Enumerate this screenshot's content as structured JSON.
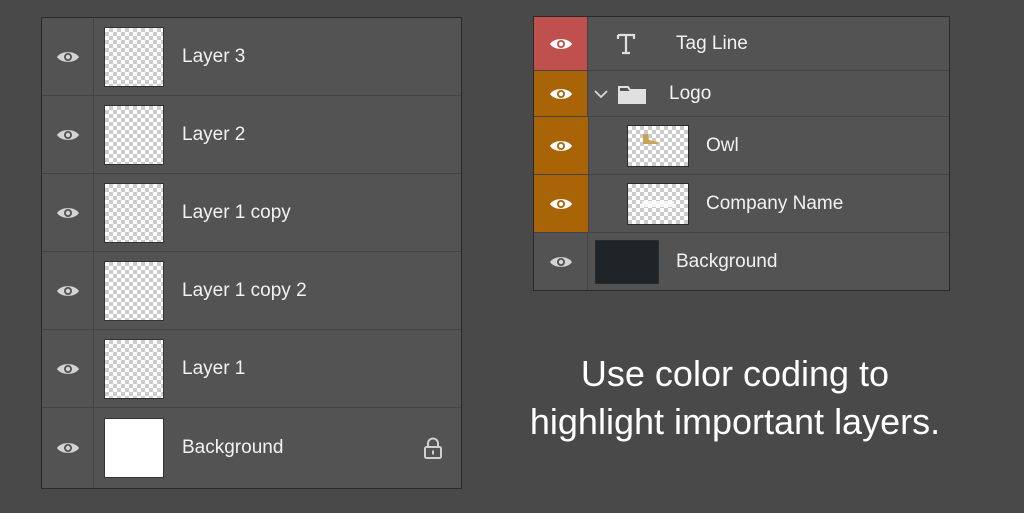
{
  "left_panel": {
    "layers": [
      {
        "name": "Layer 3",
        "thumbnail": "transparent",
        "visible": true
      },
      {
        "name": "Layer 2",
        "thumbnail": "transparent",
        "visible": true
      },
      {
        "name": "Layer 1 copy",
        "thumbnail": "transparent",
        "visible": true
      },
      {
        "name": "Layer 1 copy 2",
        "thumbnail": "transparent",
        "visible": true
      },
      {
        "name": "Layer 1",
        "thumbnail": "transparent",
        "visible": true
      },
      {
        "name": "Background",
        "thumbnail": "white",
        "visible": true,
        "locked": true,
        "lock_icon": "lock-icon"
      }
    ]
  },
  "right_panel": {
    "layers": [
      {
        "name": "Tag Line",
        "kind": "text",
        "icon": "type-icon",
        "eye_color": "#c0504d"
      },
      {
        "name": "Logo",
        "kind": "group",
        "icon": "folder-icon",
        "expanded": true,
        "eye_color": "#a86406"
      },
      {
        "name": "Owl",
        "kind": "image",
        "eye_color": "#a86406"
      },
      {
        "name": "Company Name",
        "kind": "image",
        "eye_color": "#a86406"
      },
      {
        "name": "Background",
        "kind": "fill",
        "thumbnail_color": "#1f2428",
        "eye_color": "#535353"
      }
    ]
  },
  "caption": {
    "line1": "Use color coding to",
    "line2": "highlight important layers."
  },
  "colors": {
    "page_background": "#494949",
    "panel_background": "#535353",
    "red_label": "#c0504d",
    "orange_label": "#a86406"
  }
}
